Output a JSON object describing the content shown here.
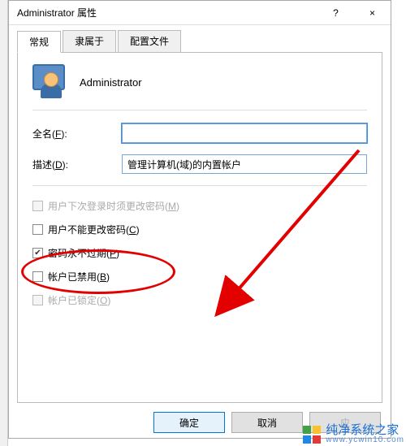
{
  "window": {
    "title": "Administrator 属性",
    "help_icon": "?",
    "close_icon": "×"
  },
  "tabs": [
    {
      "label": "常规",
      "active": true
    },
    {
      "label": "隶属于",
      "active": false
    },
    {
      "label": "配置文件",
      "active": false
    }
  ],
  "header": {
    "name": "Administrator"
  },
  "fields": {
    "fullname": {
      "label_pre": "全名(",
      "hotkey": "F",
      "label_post": "):",
      "value": ""
    },
    "desc": {
      "label_pre": "描述(",
      "hotkey": "D",
      "label_post": "):",
      "value": "管理计算机(域)的内置帐户"
    }
  },
  "checks": [
    {
      "pre": "用户下次登录时须更改密码(",
      "hk": "M",
      "post": ")",
      "checked": false,
      "disabled": true
    },
    {
      "pre": "用户不能更改密码(",
      "hk": "C",
      "post": ")",
      "checked": false,
      "disabled": false
    },
    {
      "pre": "密码永不过期(",
      "hk": "P",
      "post": ")",
      "checked": true,
      "disabled": false
    },
    {
      "pre": "帐户已禁用(",
      "hk": "B",
      "post": ")",
      "checked": false,
      "disabled": false
    },
    {
      "pre": "帐户已锁定(",
      "hk": "O",
      "post": ")",
      "checked": false,
      "disabled": true
    }
  ],
  "buttons": {
    "ok": "确定",
    "cancel": "取消",
    "apply": "应"
  },
  "watermark": {
    "line1": "纯净系统之家",
    "line2": "www.ycwin10.com"
  },
  "annotation": {
    "ellipse_class": "red-ellipse",
    "arrow_class": "arrow-svg"
  }
}
